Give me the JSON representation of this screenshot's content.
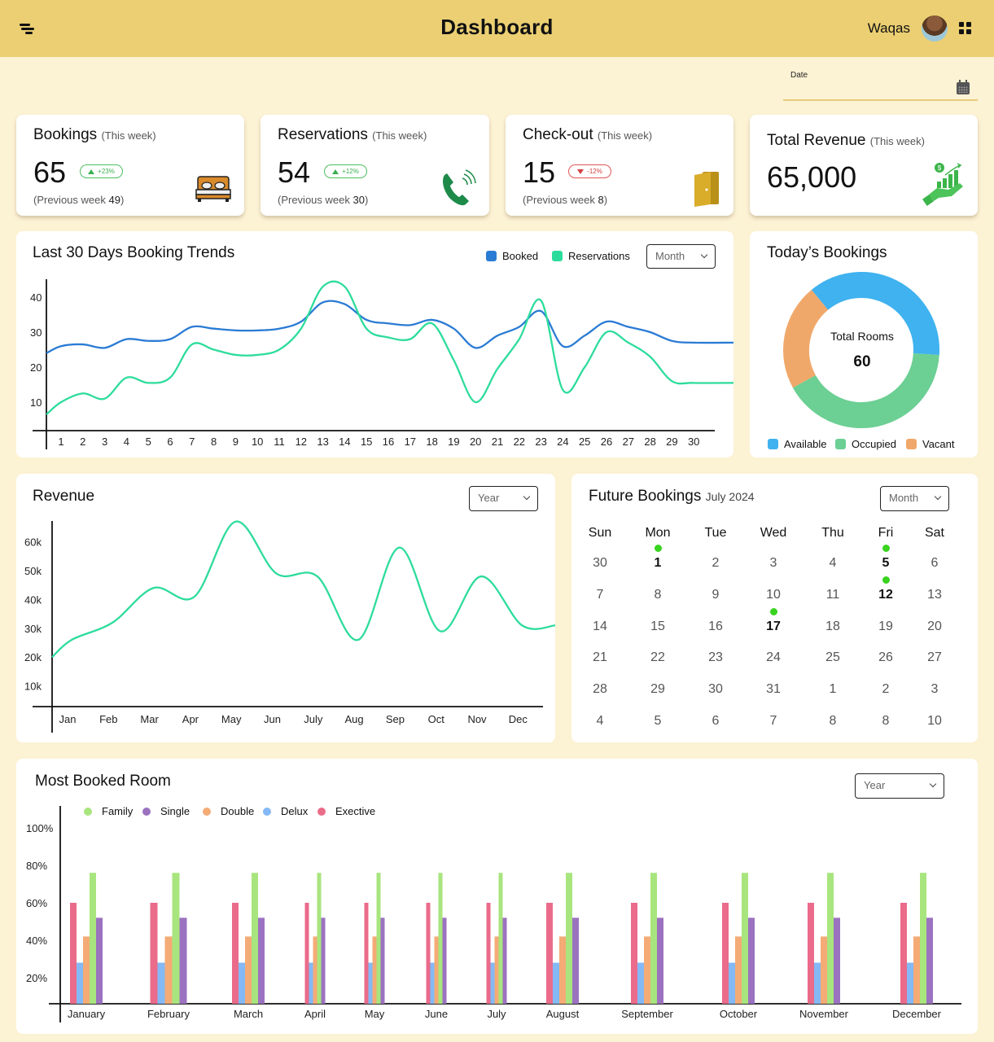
{
  "header": {
    "title": "Dashboard",
    "user_name": "Waqas",
    "menu_icon": "menu-icon",
    "apps_icon": "grid-icon"
  },
  "date_filter": {
    "label": "Date",
    "value": "",
    "icon": "calendar-icon"
  },
  "stats": [
    {
      "title": "Bookings",
      "period": "(This week)",
      "value": "65",
      "change": "+23%",
      "trend": "up",
      "prev_label": "(Previous week ",
      "prev_value": "49",
      "prev_close": ")",
      "icon": "bed-icon"
    },
    {
      "title": "Reservations",
      "period": "(This week)",
      "value": "54",
      "change": "+12%",
      "trend": "up",
      "prev_label": "(Previous week ",
      "prev_value": "30",
      "prev_close": ")",
      "icon": "phone-icon"
    },
    {
      "title": "Check-out",
      "period": "(This week)",
      "value": "15",
      "change": "-12%",
      "trend": "down",
      "prev_label": "(Previous week ",
      "prev_value": "8",
      "prev_close": ")",
      "icon": "door-icon"
    },
    {
      "title": "Total Revenue",
      "period": "(This week)",
      "value": "65,000",
      "icon": "revenue-growth-icon"
    }
  ],
  "trends": {
    "title": "Last 30 Days Booking Trends",
    "dropdown": "Month",
    "legend": [
      "Booked",
      "Reservations"
    ]
  },
  "todays": {
    "title": "Today’s Bookings",
    "center_label": "Total Rooms",
    "center_value": "60",
    "legend": [
      "Available",
      "Occupied",
      "Vacant"
    ]
  },
  "revenue": {
    "title": "Revenue",
    "dropdown": "Year"
  },
  "future": {
    "title": "Future Bookings",
    "month": "July 2024",
    "dropdown": "Month",
    "weekdays": [
      "Sun",
      "Mon",
      "Tue",
      "Wed",
      "Thu",
      "Fri",
      "Sat"
    ],
    "weeks": [
      [
        "30",
        "1",
        "2",
        "3",
        "4",
        "5",
        "6"
      ],
      [
        "7",
        "8",
        "9",
        "10",
        "11",
        "12",
        "13"
      ],
      [
        "14",
        "15",
        "16",
        "17",
        "18",
        "19",
        "20"
      ],
      [
        "21",
        "22",
        "23",
        "24",
        "25",
        "26",
        "27"
      ],
      [
        "28",
        "29",
        "30",
        "31",
        "1",
        "2",
        "3"
      ],
      [
        "4",
        "5",
        "6",
        "7",
        "8",
        "8",
        "10"
      ]
    ],
    "booked_days": [
      [
        0,
        1
      ],
      [
        0,
        5
      ],
      [
        1,
        5
      ],
      [
        2,
        3
      ]
    ]
  },
  "rooms": {
    "title": "Most Booked Room",
    "dropdown": "Year"
  },
  "colors": {
    "header_bg": "#ebcf72",
    "page_bg": "#fcf2d4",
    "booked": "#2a7bd4",
    "reservations": "#2ddc9c",
    "available": "#3fb2ef",
    "occupied": "#6ccf94",
    "vacant": "#f0a86a",
    "family": "#a8e57e",
    "single": "#9b72c0",
    "double": "#f4ab76",
    "delux": "#84b9f5",
    "exective": "#ea6b8a",
    "booking_dot": "#39d320"
  },
  "chart_data": [
    {
      "type": "line",
      "title": "Last 30 Days Booking Trends",
      "xlabel": "",
      "ylabel": "",
      "x": [
        1,
        2,
        3,
        4,
        5,
        6,
        7,
        8,
        9,
        10,
        11,
        12,
        13,
        14,
        15,
        16,
        17,
        18,
        19,
        20,
        21,
        22,
        23,
        24,
        25,
        26,
        27,
        28,
        29,
        30
      ],
      "ylim": [
        0,
        45
      ],
      "yticks": [
        10,
        20,
        30,
        40
      ],
      "grid": false,
      "legend_position": "top-right",
      "series": [
        {
          "name": "Booked",
          "values": [
            26,
            26.5,
            25.5,
            28,
            27.5,
            28,
            31.5,
            31,
            30.5,
            30.5,
            31,
            33,
            38.5,
            38,
            33.5,
            32.5,
            32,
            33.5,
            31,
            25.5,
            29,
            31.5,
            36,
            26,
            29,
            33,
            31.5,
            30,
            27.5,
            27
          ]
        },
        {
          "name": "Reservations",
          "values": [
            10,
            12.5,
            11,
            17,
            15.5,
            17,
            26.5,
            25,
            23.5,
            23.5,
            25,
            31,
            43,
            43,
            31,
            28.5,
            28,
            32.5,
            22,
            10,
            19.5,
            28,
            39,
            13.5,
            20,
            30,
            27,
            23,
            16,
            15.5
          ]
        }
      ]
    },
    {
      "type": "pie",
      "title": "Today’s Bookings",
      "categories": [
        "Available",
        "Occupied",
        "Vacant"
      ],
      "values": [
        37,
        41,
        22
      ],
      "center_text": "Total Rooms 60",
      "legend_position": "bottom"
    },
    {
      "type": "line",
      "title": "Revenue",
      "categories": [
        "Jan",
        "Feb",
        "Mar",
        "Apr",
        "May",
        "Jun",
        "July",
        "Aug",
        "Sep",
        "Oct",
        "Nov",
        "Dec"
      ],
      "yticks": [
        "10k",
        "20k",
        "30k",
        "40k",
        "50k",
        "60k"
      ],
      "ylim": [
        0,
        68000
      ],
      "grid": false,
      "series": [
        {
          "name": "Revenue",
          "values": [
            26000,
            32000,
            44000,
            41000,
            67000,
            49000,
            48000,
            26000,
            58000,
            29000,
            48000,
            31000
          ]
        }
      ]
    },
    {
      "type": "bar",
      "title": "Most Booked Room",
      "categories": [
        "January",
        "February",
        "March",
        "April",
        "May",
        "June",
        "July",
        "August",
        "September",
        "October",
        "November",
        "December"
      ],
      "yticks": [
        "20%",
        "40%",
        "60%",
        "80%",
        "100%"
      ],
      "ylim": [
        0,
        100
      ],
      "grid": false,
      "legend_position": "top-left",
      "legend_order": [
        "Family",
        "Single",
        "Double",
        "Delux",
        "Exective"
      ],
      "series": [
        {
          "name": "Exective",
          "values": [
            60,
            60,
            60,
            60,
            60,
            60,
            60,
            60,
            60,
            60,
            60,
            60
          ]
        },
        {
          "name": "Delux",
          "values": [
            28,
            28,
            28,
            28,
            28,
            28,
            28,
            28,
            28,
            28,
            28,
            28
          ]
        },
        {
          "name": "Double",
          "values": [
            42,
            42,
            42,
            42,
            42,
            42,
            42,
            42,
            42,
            42,
            42,
            42
          ]
        },
        {
          "name": "Family",
          "values": [
            76,
            76,
            76,
            76,
            76,
            76,
            76,
            76,
            76,
            76,
            76,
            76
          ]
        },
        {
          "name": "Single",
          "values": [
            52,
            52,
            52,
            52,
            52,
            52,
            52,
            52,
            52,
            52,
            52,
            52
          ]
        }
      ]
    }
  ]
}
